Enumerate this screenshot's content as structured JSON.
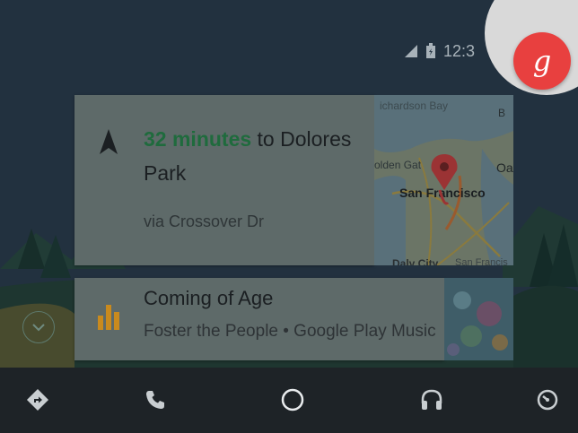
{
  "status": {
    "time": "12:3"
  },
  "navigation": {
    "minutes": "32 minutes",
    "to": " to Dolores Park",
    "via": "via Crossover Dr"
  },
  "map": {
    "labels": {
      "bay": "ichardson Bay",
      "gate": "olden Gat",
      "city": "San Francisco",
      "oak": "Oa",
      "daly": "Daly City",
      "sanfran2": "San Francis",
      "edge_b": "B"
    }
  },
  "music": {
    "song": "Coming of Age",
    "artist": "Foster the People • Google Play Music"
  },
  "assistant": {
    "glyph": "g"
  },
  "colors": {
    "accent_green": "#1f6b3d",
    "music_orange": "#c98a1e",
    "mic_red": "#e8403f",
    "navbar": "#1e2327"
  },
  "navbar": {
    "items": [
      "directions-icon",
      "phone-icon",
      "home-icon",
      "headphones-icon",
      "recents-icon"
    ]
  }
}
